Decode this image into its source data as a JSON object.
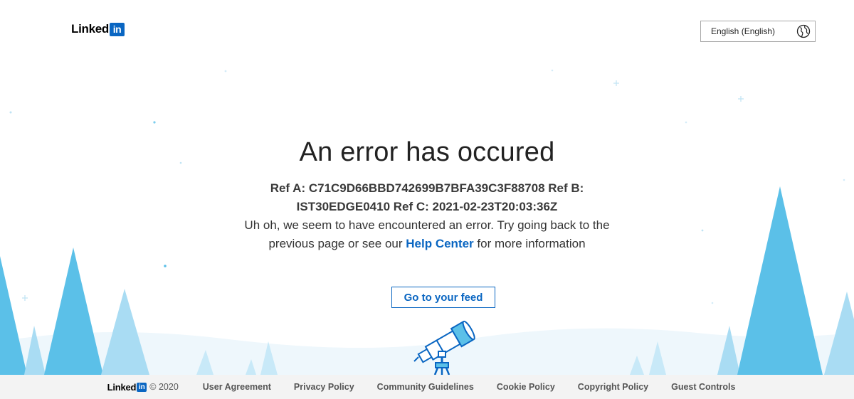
{
  "header": {
    "logo_text": "Linked",
    "logo_badge": "in",
    "language_select": {
      "value": "English (English)",
      "icon": "globe-icon"
    }
  },
  "main": {
    "title": "An error has occured",
    "refs": "Ref A: C71C9D66BBD742699B7BFA39C3F88708 Ref B: IST30EDGE0410 Ref C: 2021-02-23T20:03:36Z",
    "message_before": "Uh oh, we seem to have encountered an error. Try going back to the previous page or see our ",
    "help_link": "Help Center",
    "message_after": " for more information",
    "feed_button": "Go to your feed"
  },
  "footer": {
    "logo_text": "Linked",
    "logo_badge": "in",
    "copyright": "© 2020",
    "links": [
      "User Agreement",
      "Privacy Policy",
      "Community Guidelines",
      "Cookie Policy",
      "Copyright Policy",
      "Guest Controls"
    ]
  },
  "colors": {
    "brand": "#0a66c2",
    "tree_dark": "#5bc0e8",
    "tree_light": "#a9dcf3",
    "snow": "#eef7fc"
  }
}
